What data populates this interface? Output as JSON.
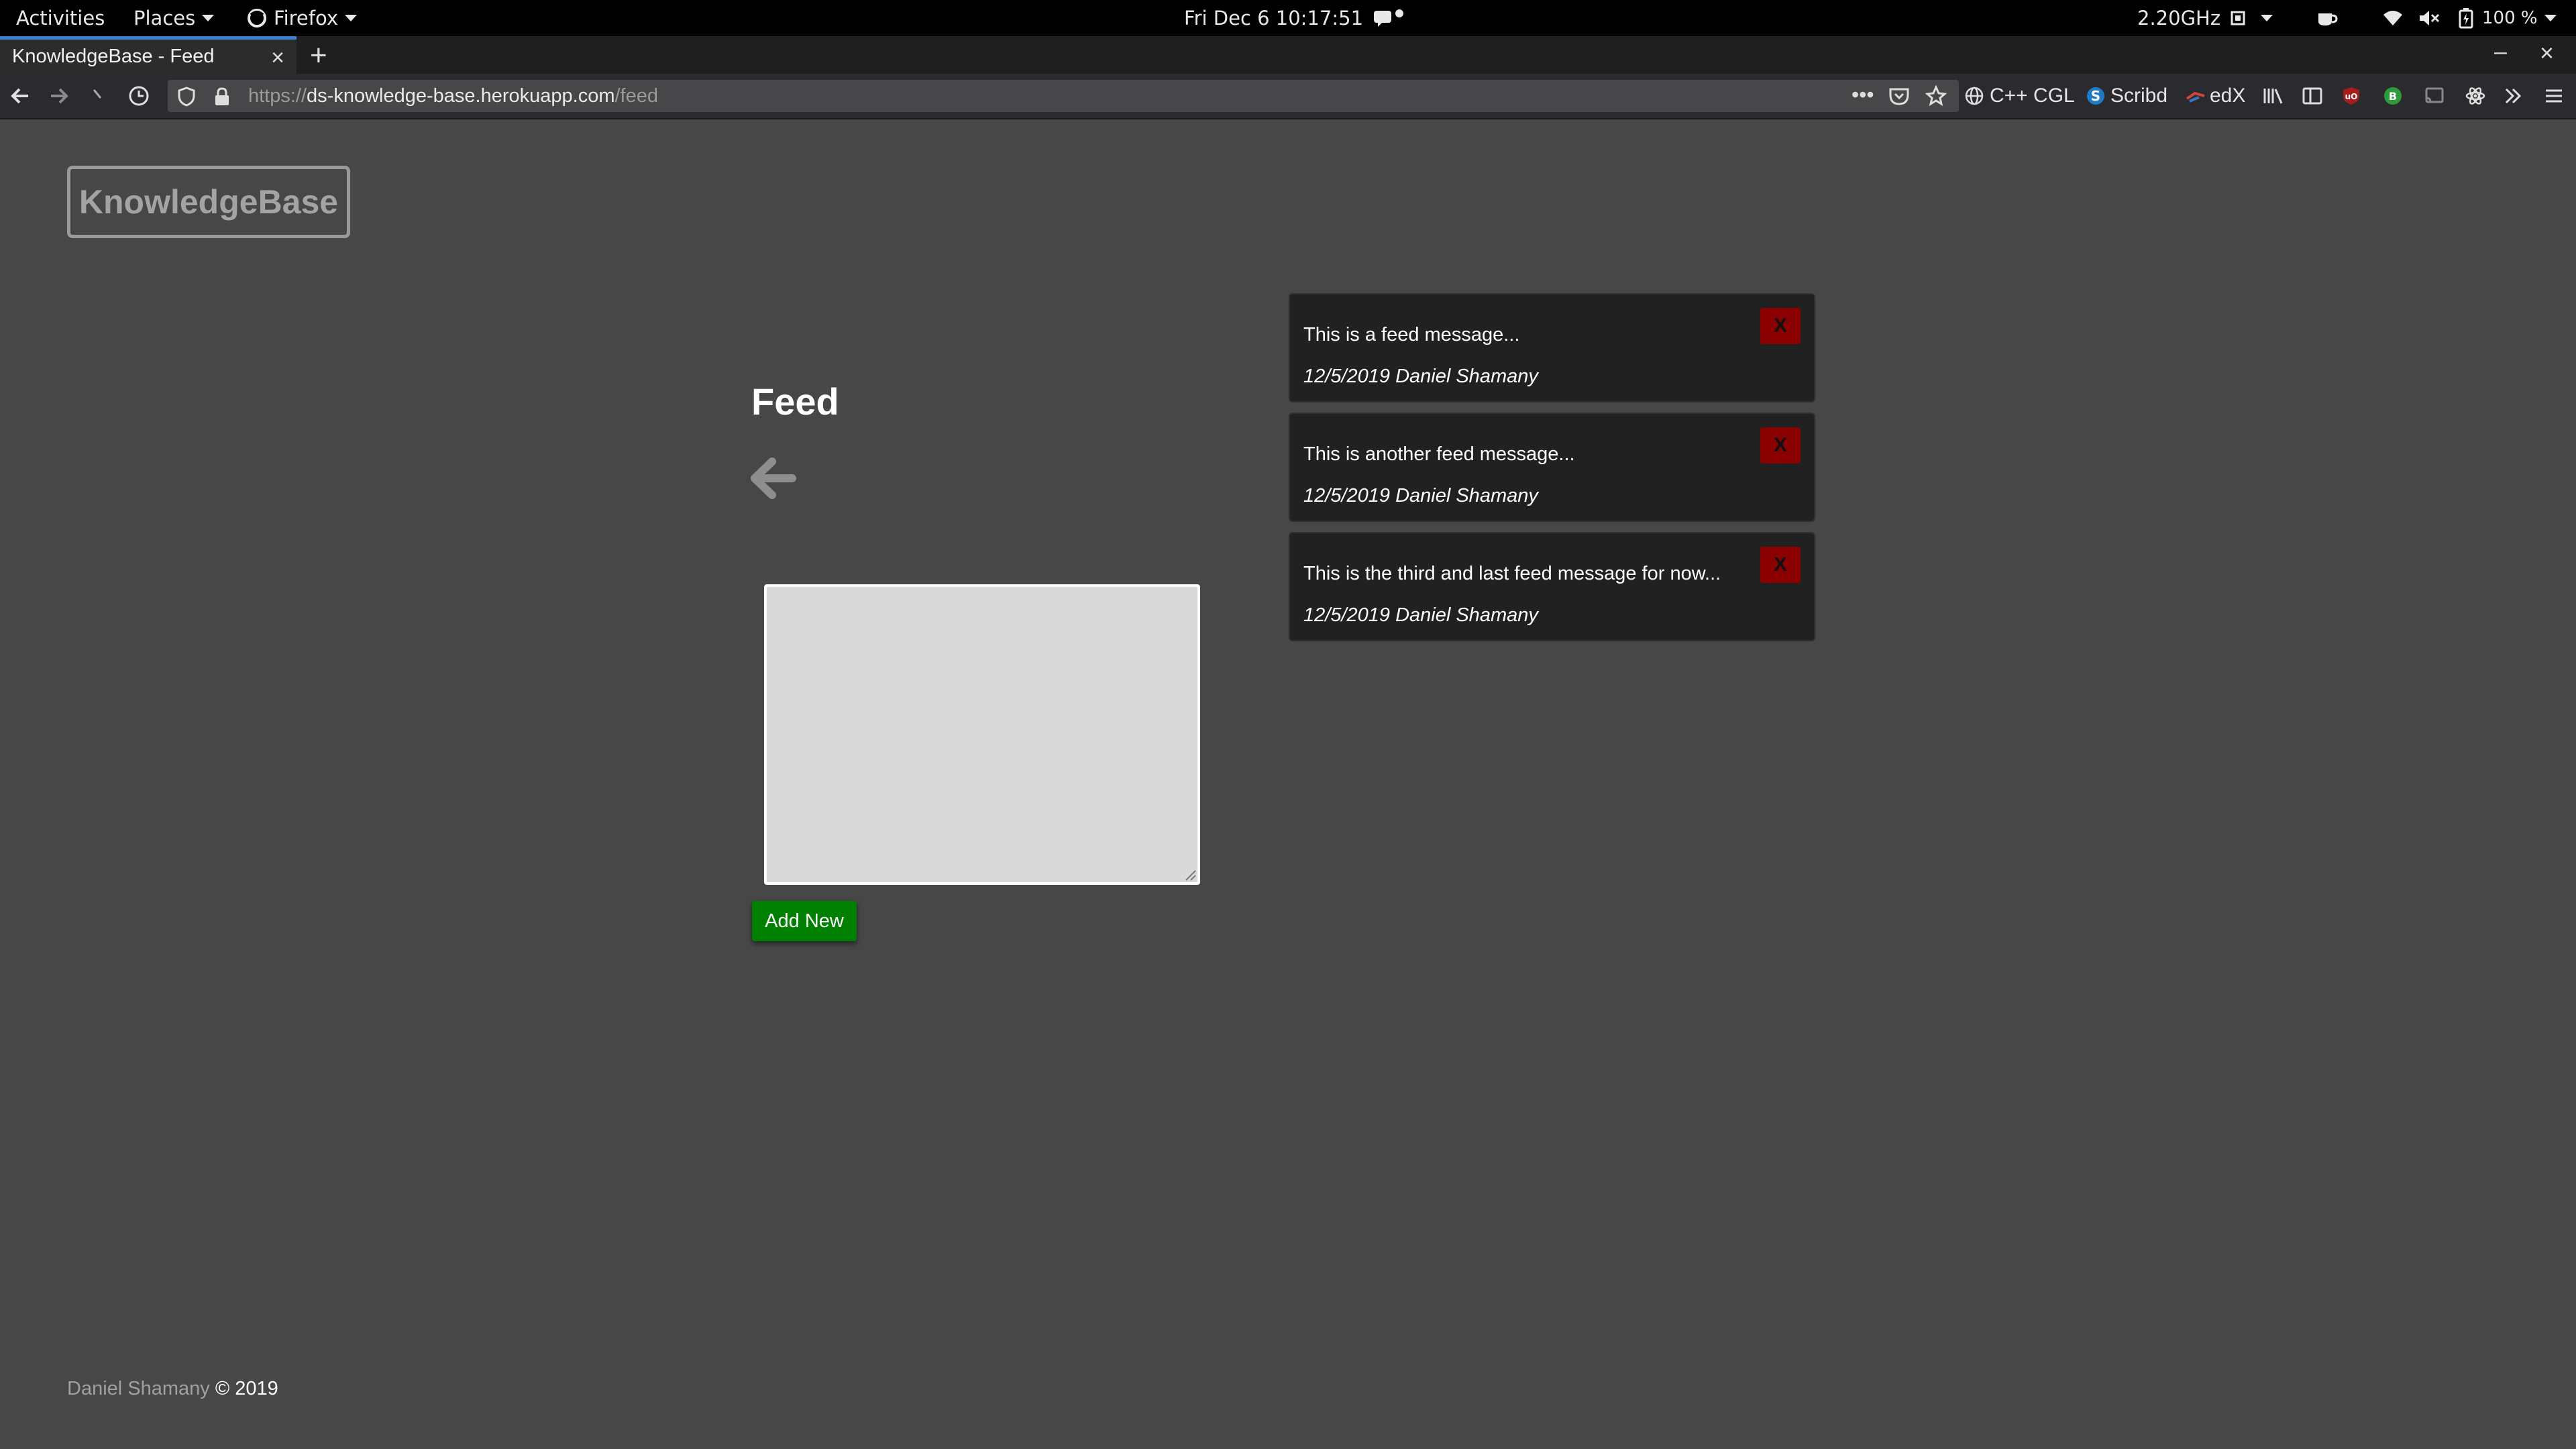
{
  "system_bar": {
    "activities": "Activities",
    "places": "Places",
    "app_menu": "Firefox",
    "clock": "Fri Dec 6  10:17:51",
    "cpu_freq": "2.20GHz",
    "battery": "100 %"
  },
  "browser": {
    "tab_title": "KnowledgeBase - Feed",
    "url_scheme": "https://",
    "url_domain": "ds-knowledge-base.herokuapp.com",
    "url_path": "/feed",
    "bookmarks": [
      "C++ CGL",
      "Scribd",
      "edX"
    ]
  },
  "page": {
    "logo": "KnowledgeBase",
    "title": "Feed",
    "add_button": "Add New",
    "delete_label": "X",
    "feed": [
      {
        "message": "This is a feed message...",
        "meta": "12/5/2019 Daniel Shamany"
      },
      {
        "message": "This is another feed message...",
        "meta": "12/5/2019 Daniel Shamany"
      },
      {
        "message": "This is the third and last feed message for now...",
        "meta": "12/5/2019 Daniel Shamany"
      }
    ],
    "footer_author": "Daniel Shamany",
    "footer_copy": "© 2019"
  },
  "colors": {
    "page_bg": "#474747",
    "card_bg": "#212121",
    "add_button": "#008000",
    "delete_button": "#8b0000"
  }
}
